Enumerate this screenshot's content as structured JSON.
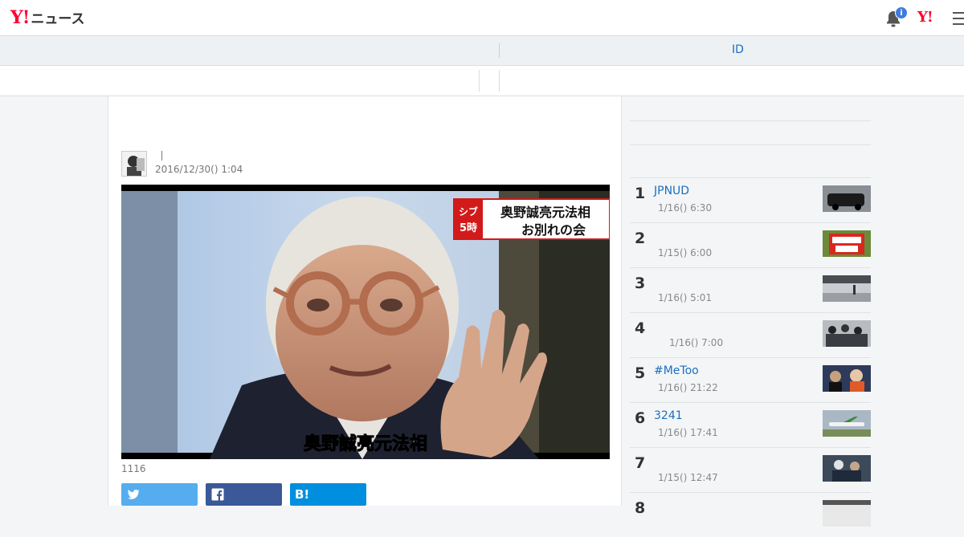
{
  "header": {
    "logo_mark": "Y!",
    "logo_text": "ニュース",
    "notification_count": "i",
    "yahoo_logo": "Y!"
  },
  "nav": {
    "id_link": "ID"
  },
  "article": {
    "title": "",
    "author_separator": "|",
    "date": "2016/12/30() 1:04",
    "caption": "1116",
    "photo_overlay": {
      "badge_line1": "シブ",
      "badge_line2": "5時",
      "headline_line1": "奥野誠亮元法相",
      "headline_line2": "お別れの会",
      "subtitle": "奥野誠亮元法相"
    },
    "share": {
      "twitter_icon": "twitter-icon",
      "facebook_icon": "facebook-icon",
      "hatena_label": "B!"
    }
  },
  "ranking": [
    {
      "num": "1",
      "title": "JPNUD",
      "date": "1/16() 6:30",
      "thumb": "black-car"
    },
    {
      "num": "2",
      "title": "",
      "date": "1/15() 6:00",
      "thumb": "red-sign"
    },
    {
      "num": "3",
      "title": "",
      "date": "1/16() 5:01",
      "thumb": "station-platform"
    },
    {
      "num": "4",
      "title": "",
      "date": "1/16() 7:00",
      "thumb": "crowd"
    },
    {
      "num": "5",
      "title": "#MeToo",
      "date": "1/16() 21:22",
      "thumb": "people"
    },
    {
      "num": "6",
      "title": "3241",
      "date": "1/16() 17:41",
      "thumb": "airplane"
    },
    {
      "num": "7",
      "title": "",
      "date": "1/15() 12:47",
      "thumb": "press"
    },
    {
      "num": "8",
      "title": "",
      "date": "",
      "thumb": "crowd2"
    }
  ],
  "colors": {
    "brand_red": "#ff0033",
    "link_blue": "#1a6fbf",
    "twitter": "#55acee",
    "facebook": "#3b5998",
    "hatena": "#008fde"
  }
}
